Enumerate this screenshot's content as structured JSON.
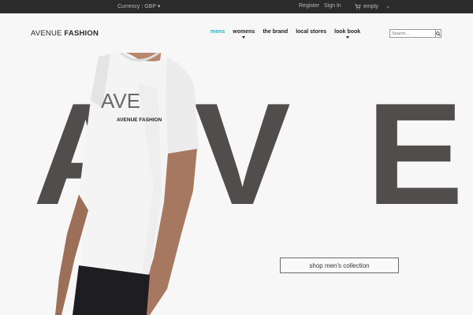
{
  "topbar": {
    "currency": "Currency : GBP",
    "register": "Register",
    "sign_in": "Sign In",
    "cart": "empty"
  },
  "header": {
    "logo_light": "AVENUE",
    "logo_bold": "FASHION",
    "nav": [
      {
        "label": "mens",
        "active": true,
        "has_caret": false
      },
      {
        "label": "womens",
        "active": false,
        "has_caret": true
      },
      {
        "label": "the brand",
        "active": false,
        "has_caret": false
      },
      {
        "label": "local stores",
        "active": false,
        "has_caret": false
      },
      {
        "label": "look book",
        "active": false,
        "has_caret": true
      }
    ],
    "search_placeholder": "Search..."
  },
  "hero": {
    "big_letters": [
      "A",
      "V",
      "E"
    ],
    "shirt_print_letters": "AVE",
    "shirt_print_text": "AVENUE FASHION",
    "cta_label": "shop men's collection"
  },
  "colors": {
    "topbar_bg": "#2b2b2b",
    "accent": "#1fb5c8",
    "big_letter": "#524d4d",
    "page_bg": "#f7f7f7"
  }
}
